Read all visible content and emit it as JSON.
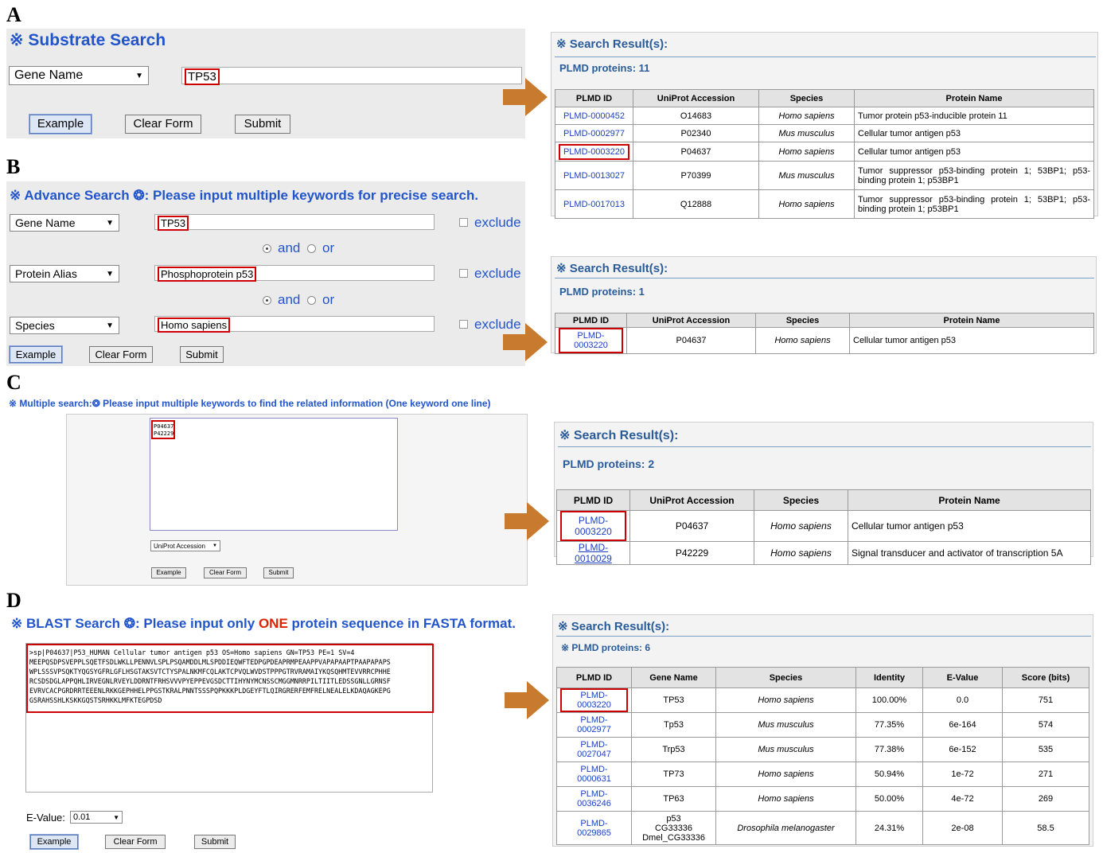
{
  "panels": {
    "A": {
      "label": "A",
      "title": "※ Substrate Search",
      "select": "Gene Name",
      "input": "TP53",
      "buttons": [
        "Example",
        "Clear Form",
        "Submit"
      ],
      "result": {
        "title": "※ Search Result(s):",
        "count": "PLMD proteins: 11",
        "headers": [
          "PLMD ID",
          "UniProt Accession",
          "Species",
          "Protein Name"
        ],
        "rows": [
          [
            "PLMD-0000452",
            "O14683",
            "Homo sapiens",
            "Tumor protein p53-inducible protein 11"
          ],
          [
            "PLMD-0002977",
            "P02340",
            "Mus musculus",
            "Cellular tumor antigen p53"
          ],
          [
            "PLMD-0003220",
            "P04637",
            "Homo sapiens",
            "Cellular tumor antigen p53"
          ],
          [
            "PLMD-0013027",
            "P70399",
            "Mus musculus",
            "Tumor suppressor p53-binding protein 1; 53BP1; p53-binding protein 1; p53BP1"
          ],
          [
            "PLMD-0017013",
            "Q12888",
            "Homo sapiens",
            "Tumor suppressor p53-binding protein 1; 53BP1; p53-binding protein 1; p53BP1"
          ]
        ]
      }
    },
    "B": {
      "label": "B",
      "title": "※ Advance Search ❂: Please input multiple keywords for precise search.",
      "rows": [
        {
          "select": "Gene Name",
          "input": "TP53",
          "exclude": "exclude"
        },
        {
          "select": "Protein Alias",
          "input": "Phosphoprotein p53",
          "exclude": "exclude"
        },
        {
          "select": "Species",
          "input": "Homo sapiens",
          "exclude": "exclude"
        }
      ],
      "and": "and",
      "or": "or",
      "buttons": [
        "Example",
        "Clear Form",
        "Submit"
      ],
      "result": {
        "title": "※ Search Result(s):",
        "count": "PLMD proteins: 1",
        "headers": [
          "PLMD ID",
          "UniProt Accession",
          "Species",
          "Protein Name"
        ],
        "rows": [
          [
            "PLMD-0003220",
            "P04637",
            "Homo sapiens",
            "Cellular tumor antigen p53"
          ]
        ]
      }
    },
    "C": {
      "label": "C",
      "title": "※ Multiple search:❂ Please input multiple keywords to find the related information (One keyword one line)",
      "textarea_lines": [
        "P04637",
        "P42229"
      ],
      "select": "UniProt Accession",
      "buttons": [
        "Example",
        "Clear Form",
        "Submit"
      ],
      "result": {
        "title": "※ Search Result(s):",
        "count": "PLMD proteins: 2",
        "headers": [
          "PLMD ID",
          "UniProt Accession",
          "Species",
          "Protein Name"
        ],
        "rows": [
          [
            "PLMD-0003220",
            "P04637",
            "Homo sapiens",
            "Cellular tumor antigen p53"
          ],
          [
            "PLMD-0010029",
            "P42229",
            "Homo sapiens",
            "Signal transducer and activator of transcription 5A"
          ]
        ]
      }
    },
    "D": {
      "label": "D",
      "title_pre": "※ BLAST Search ❂: Please input only ",
      "title_one": "ONE",
      "title_post": " protein sequence in FASTA format.",
      "fasta": ">sp|P04637|P53_HUMAN Cellular tumor antigen p53 OS=Homo sapiens GN=TP53 PE=1 SV=4\nMEEPQSDPSVEPPLSQETFSDLWKLLPENNVLSPLPSQAMDDLMLSPDDIEQWFTEDPGPDEAPRMPEAAPPVAPAPAAPTPAAPAPAPS\nWPLSSSVPSQKTYQGSYGFRLGFLHSGTAKSVTCTYSPALNKMFCQLAKTCPVQLWVDSTPPPGTRVRAMAIYKQSQHMTEVVRRCPHHE\nRCSDSDGLAPPQHLIRVEGNLRVEYLDDRNTFRHSVVVPYEPPEVGSDCTTIHYNYMCNSSCMGGMNRRPILTIITLEDSSGNLLGRNSF\nEVRVCACPGRDRRTEEENLRKKGEPHHELPPGSTKRALPNNTSSSPQPKKKPLDGEYFTLQIRGRERFEMFRELNEALELKDAQAGKEPG\nGSRAHSSHLKSKKGQSTSRHKKLMFKTEGPDSD",
      "evalue_label": "E-Value:",
      "evalue": "0.01",
      "buttons": [
        "Example",
        "Clear Form",
        "Submit"
      ],
      "result": {
        "title": "※ Search Result(s):",
        "count": "※ PLMD proteins: 6",
        "headers": [
          "PLMD ID",
          "Gene Name",
          "Species",
          "Identity",
          "E-Value",
          "Score (bits)"
        ],
        "rows": [
          [
            "PLMD-\n0003220",
            "TP53",
            "Homo sapiens",
            "100.00%",
            "0.0",
            "751"
          ],
          [
            "PLMD-\n0002977",
            "Tp53",
            "Mus musculus",
            "77.35%",
            "6e-164",
            "574"
          ],
          [
            "PLMD-\n0027047",
            "Trp53",
            "Mus musculus",
            "77.38%",
            "6e-152",
            "535"
          ],
          [
            "PLMD-\n0000631",
            "TP73",
            "Homo sapiens",
            "50.94%",
            "1e-72",
            "271"
          ],
          [
            "PLMD-\n0036246",
            "TP63",
            "Homo sapiens",
            "50.00%",
            "4e-72",
            "269"
          ],
          [
            "PLMD-\n0029865",
            "p53\nCG33336\nDmel_CG33336",
            "Drosophila melanogaster",
            "24.31%",
            "2e-08",
            "58.5"
          ]
        ]
      }
    }
  }
}
